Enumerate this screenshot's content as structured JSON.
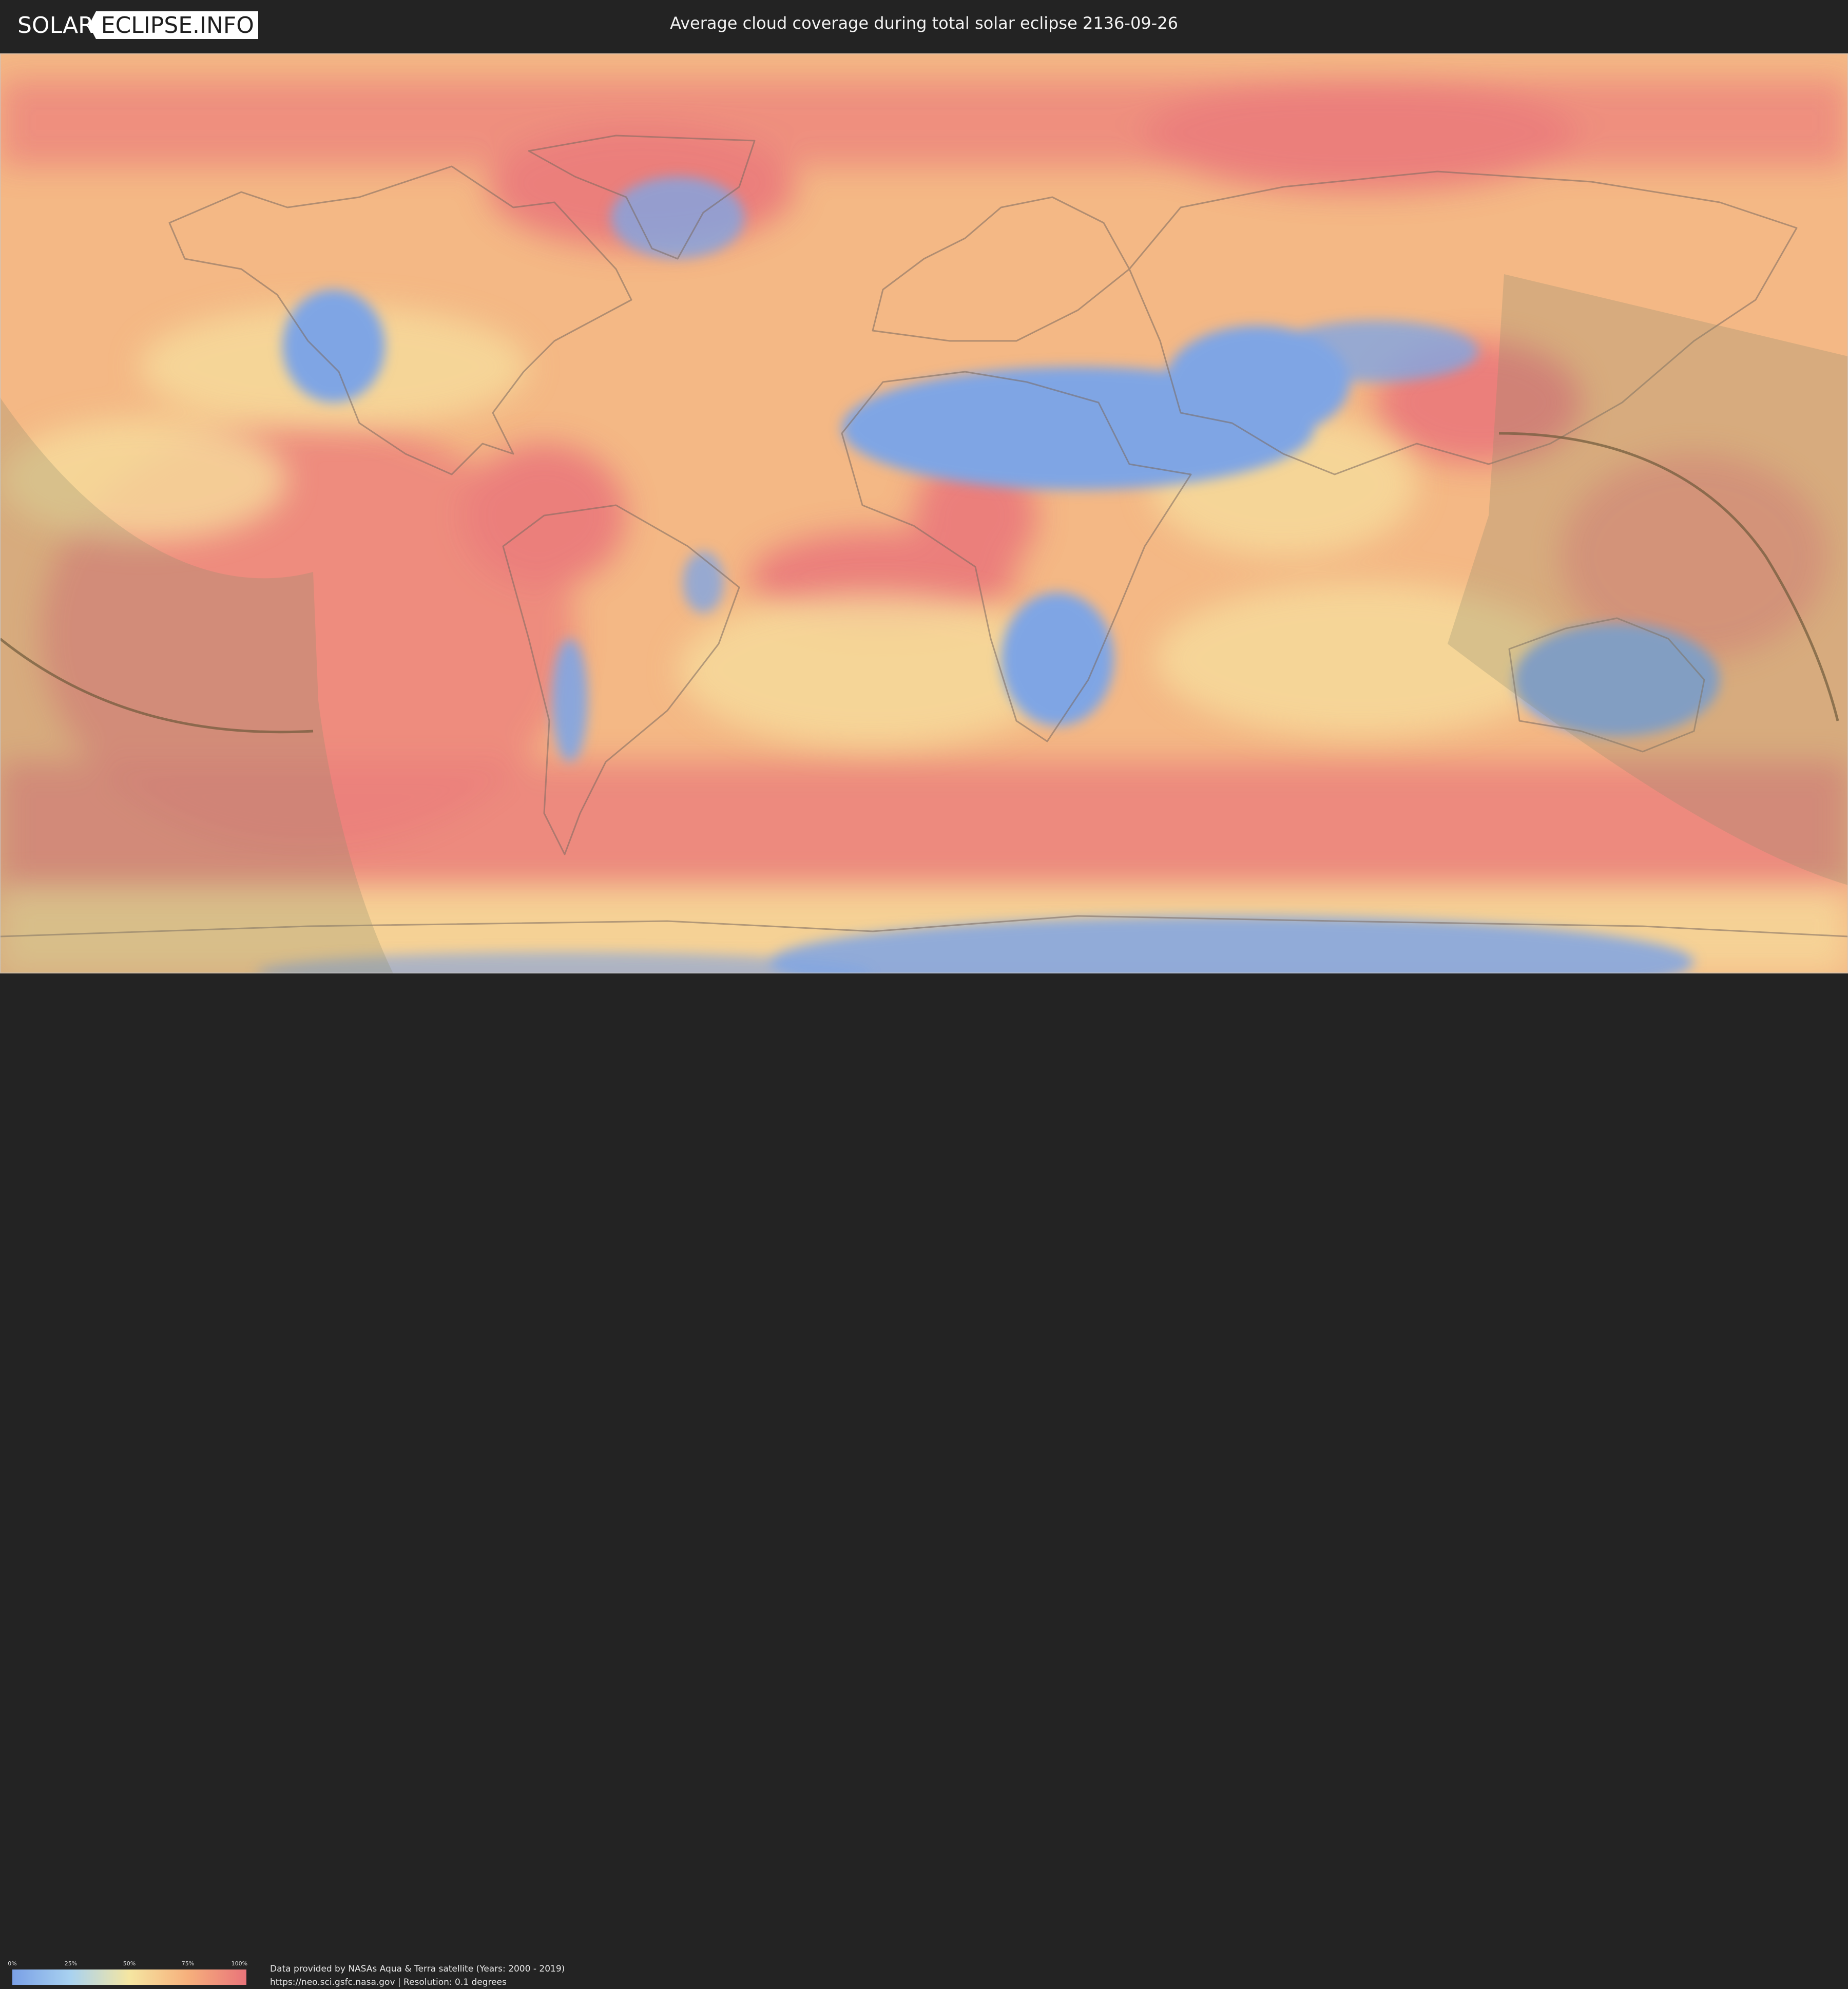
{
  "header": {
    "logo_left": "SOLAR",
    "logo_right": "ECLIPSE.INFO",
    "title": "Average cloud coverage during total solar eclipse 2136-09-26"
  },
  "map": {
    "colors": {
      "clear": "#7aa0e6",
      "low": "#a9d2f0",
      "medium": "#f5e6a2",
      "high": "#f6b07c",
      "overcast": "#e9747a",
      "eclipse_band": "#8c8c6a",
      "centerline": "#6e5a3a"
    }
  },
  "legend": {
    "ticks": [
      "0%",
      "25%",
      "50%",
      "75%",
      "100%"
    ]
  },
  "credits": {
    "line1": "Data provided by NASAs Aqua & Terra satellite (Years: 2000 - 2019)",
    "line2": "https://neo.sci.gsfc.nasa.gov | Resolution: 0.1 degrees"
  }
}
